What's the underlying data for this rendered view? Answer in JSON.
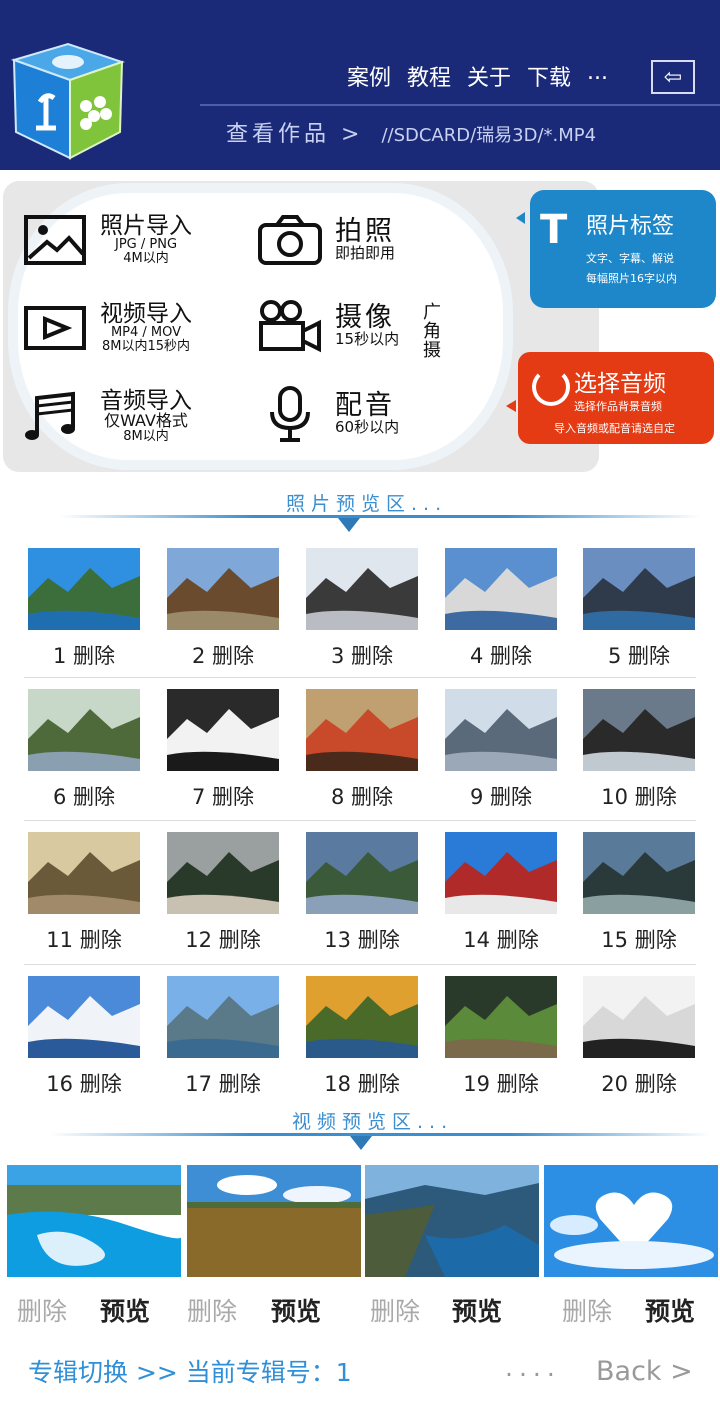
{
  "header": {
    "nav": [
      "案例",
      "教程",
      "关于",
      "下载",
      "..."
    ],
    "back_glyph": "⇦",
    "works_label": "查看作品 >",
    "works_path": "//SDCARD/瑞易3D/*.MP4"
  },
  "tools": {
    "photo_import": {
      "title": "照片导入",
      "sub1": "JPG / PNG",
      "sub2": "4M以内"
    },
    "take_photo": {
      "title": "拍照",
      "sub1": "即拍即用"
    },
    "video_import": {
      "title": "视频导入",
      "sub1": "MP4 / MOV",
      "sub2": "8M以内15秒内"
    },
    "record_video": {
      "title": "摄像",
      "side": "广角摄",
      "sub1": "15秒以内"
    },
    "audio_import": {
      "title": "音频导入",
      "sub1": "仅WAV格式",
      "sub2": "8M以内"
    },
    "dubbing": {
      "title": "配音",
      "sub1": "60秒以内"
    }
  },
  "photo_label_card": {
    "icon": "T",
    "title": "照片标签",
    "line1": "文字、字幕、解说",
    "line2": "每幅照片16字以内"
  },
  "audio_card": {
    "title": "选择音频",
    "line1": "选择作品背景音频",
    "line2": "导入音频或配音请选自定"
  },
  "photo_section": {
    "title": "照片预览区..."
  },
  "photos": [
    {
      "caption": "1 删除"
    },
    {
      "caption": "2 删除"
    },
    {
      "caption": "3 删除"
    },
    {
      "caption": "4 删除"
    },
    {
      "caption": "5 删除"
    },
    {
      "caption": "6 删除"
    },
    {
      "caption": "7 删除"
    },
    {
      "caption": "8 删除"
    },
    {
      "caption": "9 删除"
    },
    {
      "caption": "10 删除"
    },
    {
      "caption": "11 删除"
    },
    {
      "caption": "12 删除"
    },
    {
      "caption": "13 删除"
    },
    {
      "caption": "14 删除"
    },
    {
      "caption": "15 删除"
    },
    {
      "caption": "16 删除"
    },
    {
      "caption": "17 删除"
    },
    {
      "caption": "18 删除"
    },
    {
      "caption": "19 删除"
    },
    {
      "caption": "20 删除"
    }
  ],
  "video_section": {
    "title": "视频预览区..."
  },
  "videos": [
    {
      "delete": "删除",
      "preview": "预览"
    },
    {
      "delete": "删除",
      "preview": "预览"
    },
    {
      "delete": "删除",
      "preview": "预览"
    },
    {
      "delete": "删除",
      "preview": "预览"
    }
  ],
  "footer": {
    "album_switch": "专辑切换 >> 当前专辑号：1",
    "dots": "....",
    "back": "Back >"
  },
  "colors": {
    "header_bg": "#1b2a78",
    "accent_blue": "#2f8fd8",
    "label_card": "#1d87c9",
    "audio_card": "#e43b14"
  }
}
